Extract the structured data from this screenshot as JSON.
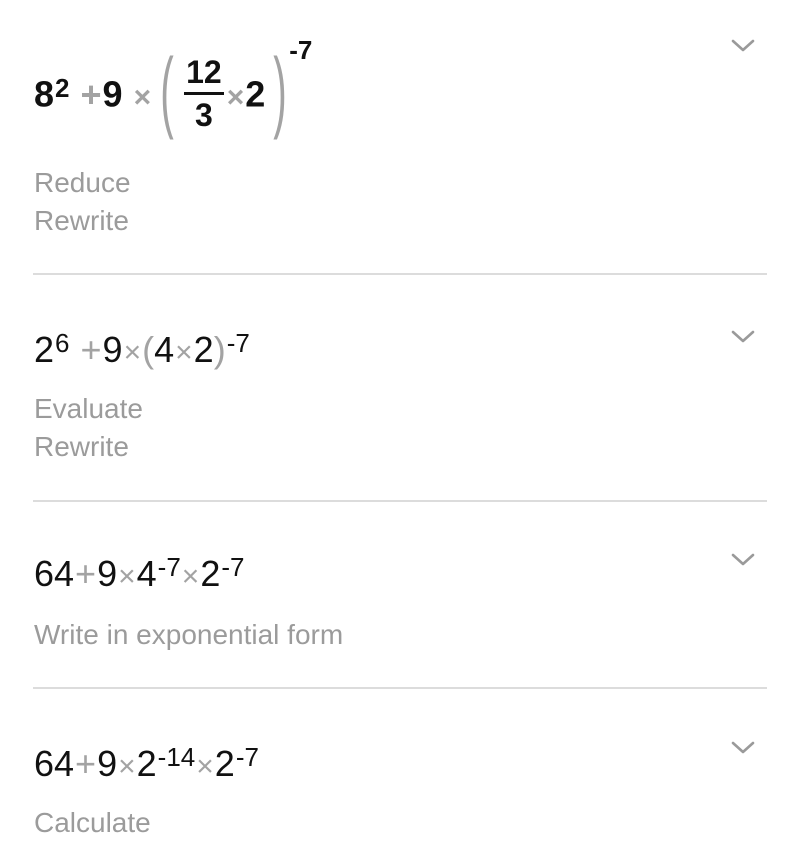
{
  "steps": [
    {
      "expression": {
        "base1": "8",
        "exp1": "2",
        "plus": "+",
        "coef": "9",
        "times1": "×",
        "numerator": "12",
        "denominator": "3",
        "times2": "×",
        "factor": "2",
        "outer_exp": "-7",
        "text": "8^2 + 9 × (12/3 × 2)^-7"
      },
      "labels": [
        "Reduce",
        "Rewrite"
      ],
      "expand_icon": "chevron-down-icon"
    },
    {
      "expression": {
        "base1": "2",
        "exp1": "6",
        "plus": "+",
        "coef": "9",
        "times1": "×",
        "open_paren": "(",
        "a": "4",
        "times2": "×",
        "b": "2",
        "close_paren": ")",
        "outer_exp": "-7",
        "text": "2^6 + 9 × (4 × 2)^-7"
      },
      "labels": [
        "Evaluate",
        "Rewrite"
      ],
      "expand_icon": "chevron-down-icon"
    },
    {
      "expression": {
        "term1": "64",
        "plus": "+",
        "coef": "9",
        "times1": "×",
        "base2": "4",
        "exp2": "-7",
        "times2": "×",
        "base3": "2",
        "exp3": "-7",
        "text": "64 + 9 × 4^-7 × 2^-7"
      },
      "labels": [
        "Write in exponential form"
      ],
      "expand_icon": "chevron-down-icon"
    },
    {
      "expression": {
        "term1": "64",
        "plus": "+",
        "coef": "9",
        "times1": "×",
        "base2": "2",
        "exp2": "-14",
        "times2": "×",
        "base3": "2",
        "exp3": "-7",
        "text": "64 + 9 × 2^-14 × 2^-7"
      },
      "labels": [
        "Calculate"
      ],
      "expand_icon": "chevron-down-icon"
    }
  ],
  "colors": {
    "text": "#111111",
    "operator": "#a3a3a3",
    "label": "#9b9b9b",
    "divider": "#dcdcdc",
    "chevron": "#9a9a9a"
  }
}
